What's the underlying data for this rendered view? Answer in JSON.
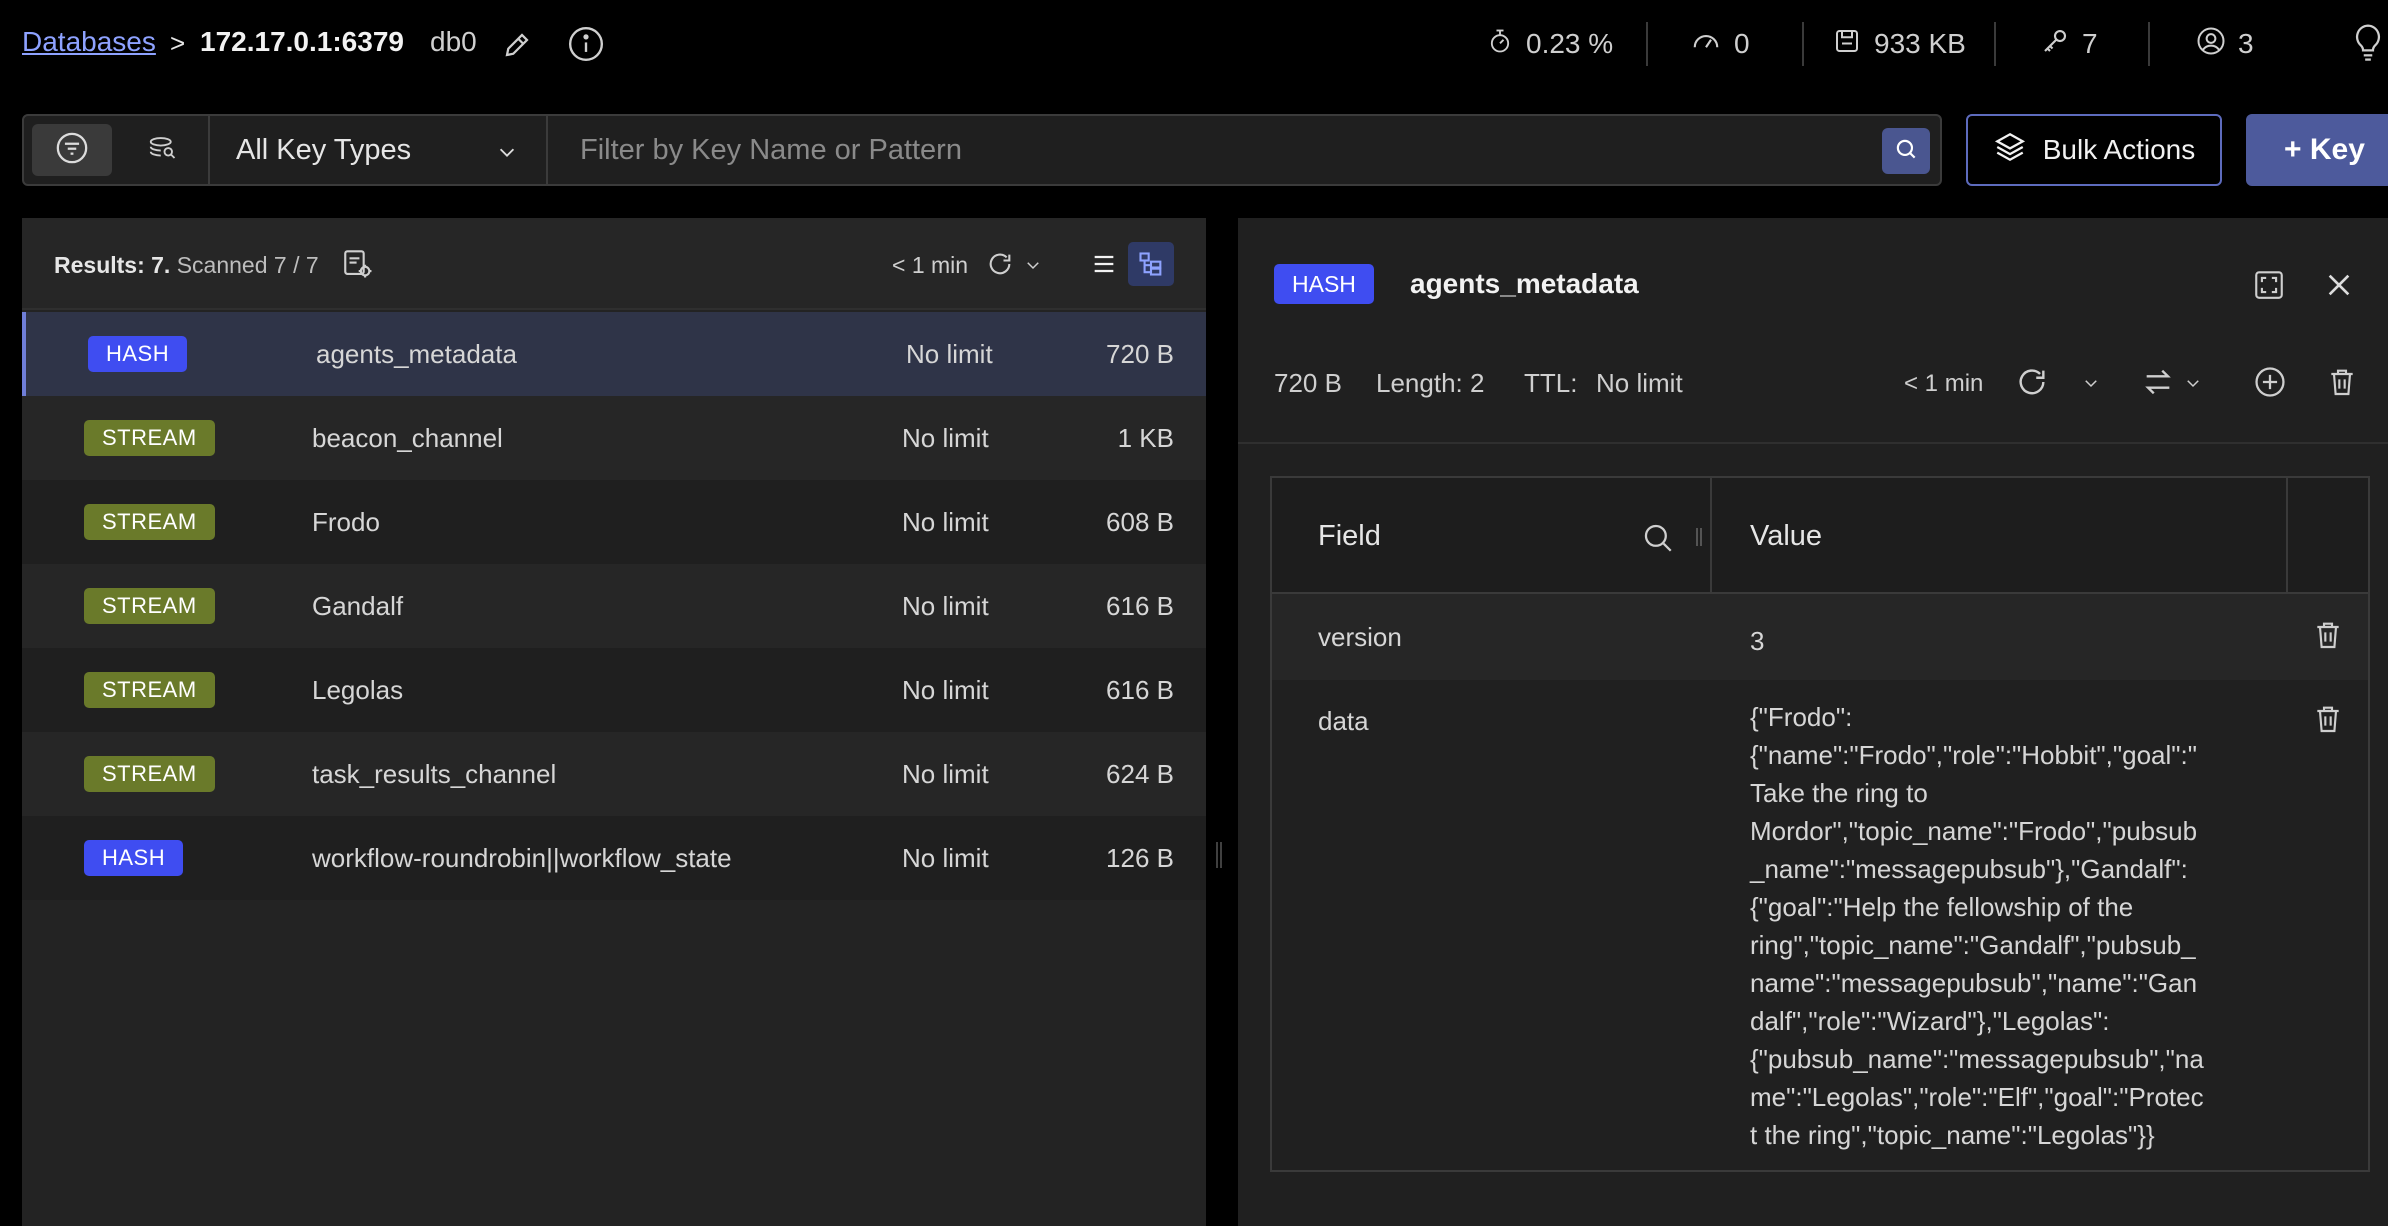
{
  "breadcrumb": {
    "databases_label": "Databases",
    "separator": ">",
    "host": "172.17.0.1:6379",
    "db_name": "db0"
  },
  "stats": {
    "cpu": "0.23 %",
    "ops": "0",
    "memory": "933 KB",
    "keys": "7",
    "clients": "3"
  },
  "filter": {
    "key_type_selected": "All Key Types",
    "search_placeholder": "Filter by Key Name or Pattern",
    "bulk_actions_label": "Bulk Actions",
    "add_key_label": "+ Key"
  },
  "list": {
    "results_label": "Results: 7.",
    "scanned_label": "Scanned 7 / 7",
    "refresh_time": "< 1 min",
    "rows": [
      {
        "type": "HASH",
        "name": "agents_metadata",
        "ttl": "No limit",
        "size": "720 B"
      },
      {
        "type": "STREAM",
        "name": "beacon_channel",
        "ttl": "No limit",
        "size": "1 KB"
      },
      {
        "type": "STREAM",
        "name": "Frodo",
        "ttl": "No limit",
        "size": "608 B"
      },
      {
        "type": "STREAM",
        "name": "Gandalf",
        "ttl": "No limit",
        "size": "616 B"
      },
      {
        "type": "STREAM",
        "name": "Legolas",
        "ttl": "No limit",
        "size": "616 B"
      },
      {
        "type": "STREAM",
        "name": "task_results_channel",
        "ttl": "No limit",
        "size": "624 B"
      },
      {
        "type": "HASH",
        "name": "workflow-roundrobin||workflow_state",
        "ttl": "No limit",
        "size": "126 B"
      }
    ]
  },
  "details": {
    "type": "HASH",
    "key_name": "agents_metadata",
    "size": "720 B",
    "length": "Length: 2",
    "ttl_label": "TTL:",
    "ttl_value": "No limit",
    "refresh_time": "< 1 min",
    "columns": {
      "field": "Field",
      "value": "Value"
    },
    "fields": [
      {
        "field": "version",
        "value": "3"
      },
      {
        "field": "data",
        "value": "{\"Frodo\":\n{\"name\":\"Frodo\",\"role\":\"Hobbit\",\"goal\":\"\nTake the ring to\nMordor\",\"topic_name\":\"Frodo\",\"pubsub\n_name\":\"messagepubsub\"},\"Gandalf\":\n{\"goal\":\"Help the fellowship of the\nring\",\"topic_name\":\"Gandalf\",\"pubsub_\nname\":\"messagepubsub\",\"name\":\"Gan\ndalf\",\"role\":\"Wizard\"},\"Legolas\":\n{\"pubsub_name\":\"messagepubsub\",\"na\nme\":\"Legolas\",\"role\":\"Elf\",\"goal\":\"Protec\nt the ring\",\"topic_name\":\"Legolas\"}}"
      }
    ]
  },
  "colors": {
    "hash_badge": "#3f4df1",
    "stream_badge": "#6a7a2a",
    "accent": "#4d5a9c",
    "link": "#8ea2ff"
  }
}
